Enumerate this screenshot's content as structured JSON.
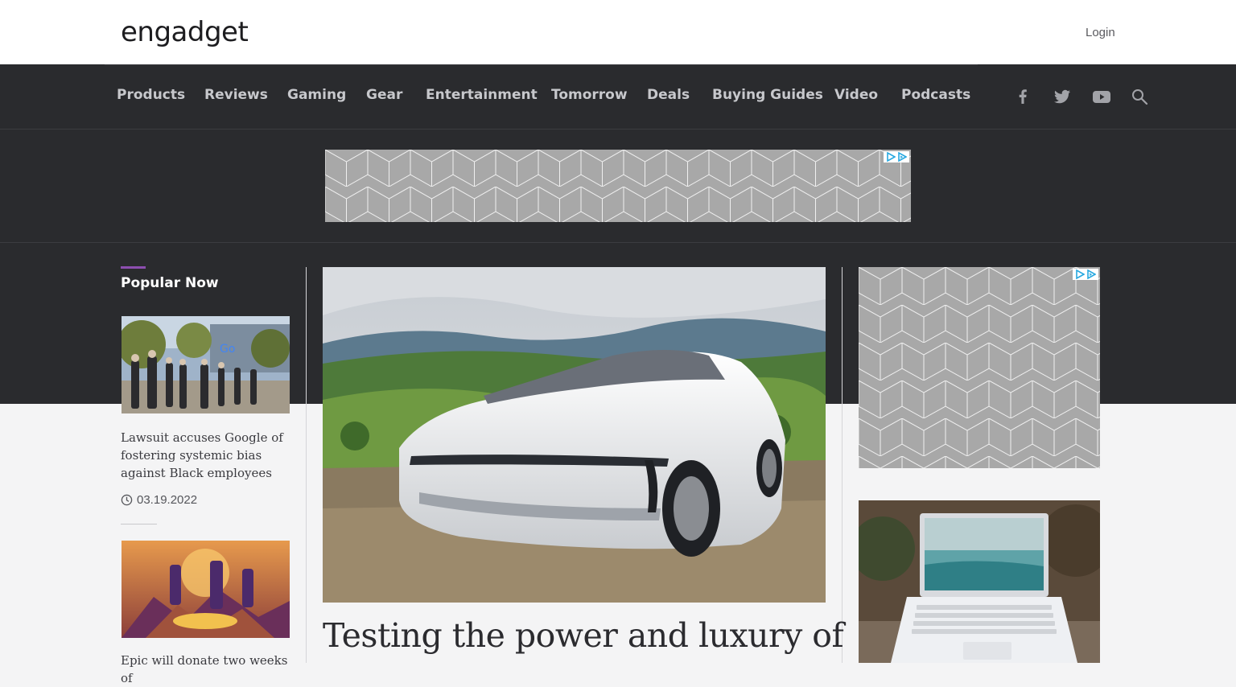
{
  "header": {
    "logo": "engadget",
    "login_label": "Login"
  },
  "nav": {
    "items": [
      "Products",
      "Reviews",
      "Gaming",
      "Gear",
      "Entertainment",
      "Tomorrow",
      "Deals",
      "Buying Guides",
      "Video",
      "Podcasts"
    ],
    "social_icons": [
      "facebook-icon",
      "twitter-icon",
      "youtube-icon",
      "search-icon"
    ]
  },
  "popular": {
    "title": "Popular Now",
    "items": [
      {
        "headline": "Lawsuit accuses Google of fostering systemic bias against Black employees",
        "date": "03.19.2022"
      },
      {
        "headline": "Epic will donate two weeks of"
      }
    ]
  },
  "featured": {
    "title": "Testing the power and luxury of"
  },
  "colors": {
    "dark_bg": "#2a2b2e",
    "accent": "#8d4eb0",
    "page_bg": "#f4f4f5"
  }
}
